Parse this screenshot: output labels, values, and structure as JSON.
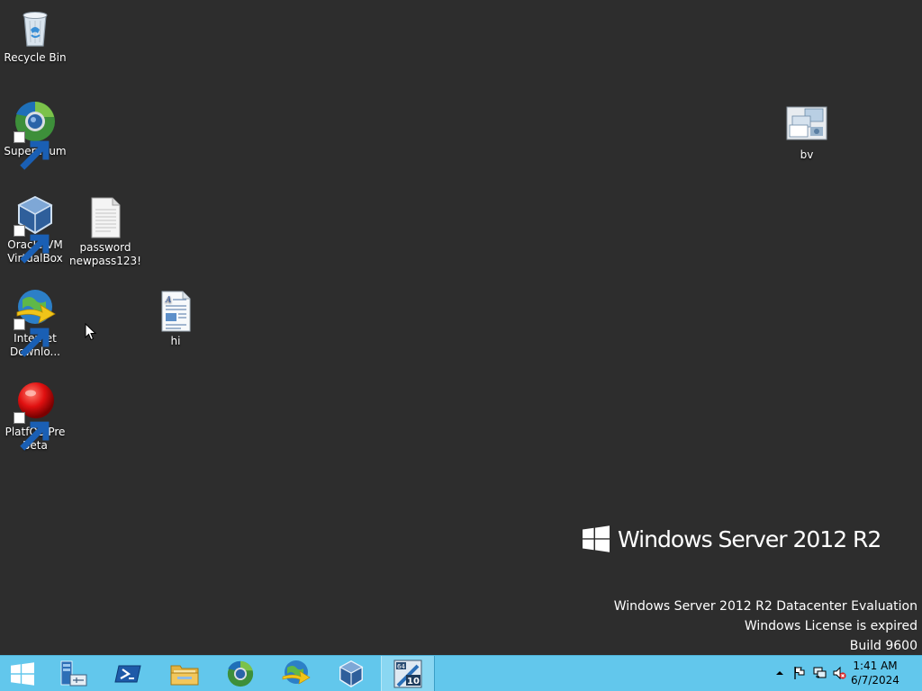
{
  "desktop": {
    "icons": [
      {
        "label": "Recycle Bin"
      },
      {
        "label": "Supermium"
      },
      {
        "label": "Oracle VM VirtualBox"
      },
      {
        "label": "password newpass123!"
      },
      {
        "label": "Internet Downlo..."
      },
      {
        "label": "hi"
      },
      {
        "label": "PlatfOS Pre Beta"
      },
      {
        "label": "bv"
      }
    ]
  },
  "branding": {
    "product": "Windows Server 2012 R2"
  },
  "watermark": {
    "line1": "Windows Server 2012 R2 Datacenter Evaluation",
    "line2": "Windows License is expired",
    "line3": "Build 9600"
  },
  "taskbar": {
    "buttons": [
      {
        "icon": "windows-start-icon"
      },
      {
        "icon": "server-manager-icon"
      },
      {
        "icon": "powershell-icon"
      },
      {
        "icon": "file-explorer-icon"
      },
      {
        "icon": "supermium-icon"
      },
      {
        "icon": "internet-download-manager-icon"
      },
      {
        "icon": "virtualbox-icon"
      },
      {
        "icon": "windows-10-64bit-app-icon"
      }
    ],
    "tray": {
      "icons": [
        "show-hidden-icons-arrow",
        "action-center-flag-icon",
        "network-icon",
        "speaker-muted-icon"
      ]
    },
    "clock": {
      "time": "1:41 AM",
      "date": "6/7/2024"
    }
  },
  "colors": {
    "desktop_background": "#2d2d2d",
    "taskbar": "#62c7ec",
    "text": "#ffffff"
  }
}
